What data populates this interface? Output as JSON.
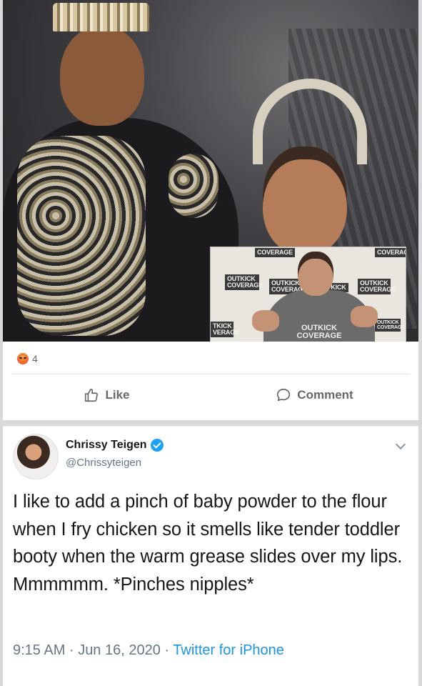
{
  "facebook_post": {
    "photo": {
      "description_icons": "photo-with-inset-video",
      "inset_logos": [
        "COVERAGE",
        "COVERAGE",
        "OUTKICK COVERAGE",
        "OUTKICK COVERAGE",
        "TKICK",
        "OUTKICK COVERAGE",
        "OUTKICK COVERAGE",
        "TKICK VERAGE",
        "OUTKICK COVERAGE"
      ],
      "shirt_logo": "OUTKICK COVERAGE"
    },
    "reactions": {
      "icon": "angry-reaction-icon",
      "count": "4"
    },
    "actions": {
      "like_label": "Like",
      "comment_label": "Comment"
    }
  },
  "tweet": {
    "display_name": "Chrissy Teigen",
    "verified": true,
    "handle": "@Chrissyteigen",
    "text": "I like to add a pinch of baby powder to the flour when I fry chicken so it smells like tender toddler booty when the warm grease slides over my lips. Mmmmmm. *Pinches nipples*",
    "time": "9:15 AM",
    "separator": "·",
    "date": "Jun 16, 2020",
    "source": "Twitter for iPhone"
  },
  "colors": {
    "facebook_gray_text": "#65676b",
    "twitter_blue": "#1da1f2",
    "twitter_link": "#1b95e0",
    "twitter_secondary": "#657786",
    "angry_orange": "#e8612c"
  }
}
